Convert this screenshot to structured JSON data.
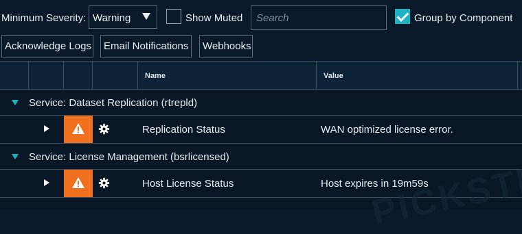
{
  "filters": {
    "severity_label": "Minimum Severity:",
    "severity_value": "Warning",
    "show_muted_label": "Show Muted",
    "show_muted_checked": false,
    "search_placeholder": "Search",
    "search_value": "",
    "group_by_label": "Group by Component",
    "group_by_checked": true
  },
  "buttons": {
    "acknowledge": "Acknowledge Logs",
    "email": "Email Notifications",
    "webhooks": "Webhooks"
  },
  "grid": {
    "columns": {
      "name": "Name",
      "value": "Value"
    },
    "groups": [
      {
        "label": "Service: Dataset Replication (rtrepld)",
        "rows": [
          {
            "name": "Replication Status",
            "value": "WAN optimized license error.",
            "severity": "warning"
          }
        ]
      },
      {
        "label": "Service: License Management (bsrlicensed)",
        "rows": [
          {
            "name": "Host License Status",
            "value": "Host expires in 19m59s",
            "severity": "warning"
          }
        ]
      }
    ]
  },
  "watermark": "PICKSTI",
  "colors": {
    "accent": "#1cb3c4",
    "warning": "#f0701e",
    "background": "#0b1a2b"
  },
  "icons": {
    "group_toggle": "triangle-down-icon",
    "row_expand": "play-icon",
    "severity": "warning-icon",
    "settings": "gear-icon"
  }
}
